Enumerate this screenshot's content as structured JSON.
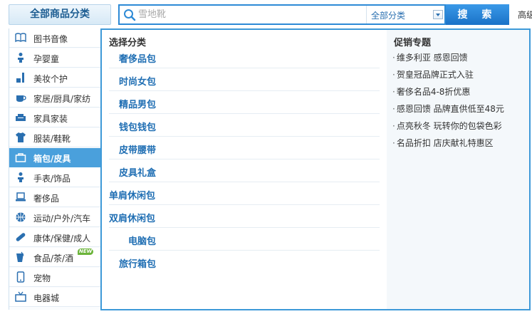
{
  "header": {
    "all_categories_label": "全部商品分类",
    "search_placeholder": "雪地靴",
    "search_category": "全部分类",
    "search_button": "搜 索",
    "advanced_search": "高级"
  },
  "sidebar": {
    "items": [
      {
        "label": "图书音像",
        "icon": "book-icon"
      },
      {
        "label": "孕婴童",
        "icon": "baby-icon"
      },
      {
        "label": "美妆个护",
        "icon": "cosmetics-icon"
      },
      {
        "label": "家居/厨具/家纺",
        "icon": "cup-icon"
      },
      {
        "label": "家具家装",
        "icon": "sofa-icon"
      },
      {
        "label": "服装/鞋靴",
        "icon": "shirt-icon"
      },
      {
        "label": "箱包/皮具",
        "icon": "bag-icon"
      },
      {
        "label": "手表/饰品",
        "icon": "watch-icon"
      },
      {
        "label": "奢侈品",
        "icon": "laptop-icon"
      },
      {
        "label": "运动/户外/汽车",
        "icon": "ball-icon"
      },
      {
        "label": "康体/保健/成人",
        "icon": "pill-icon"
      },
      {
        "label": "食品/茶/酒",
        "icon": "drink-icon",
        "badge": "NEW"
      },
      {
        "label": "宠物",
        "icon": "phone-icon"
      },
      {
        "label": "电器城",
        "icon": "tv-icon"
      }
    ],
    "active_index": 6
  },
  "panel": {
    "select_title": "选择分类",
    "subcategories": [
      "奢侈品包",
      "时尚女包",
      "精品男包",
      "钱包钱包",
      "皮带腰带",
      "皮具礼盒",
      "单肩休闲包",
      "双肩休闲包",
      "电脑包",
      "旅行箱包"
    ],
    "promo_title": "促销专题",
    "promos": [
      "维多利亚 感恩回馈",
      "贺皇冠品牌正式入驻",
      "奢侈名品4-8折优惠",
      "感恩回馈 品牌直供低至48元",
      "点亮秋冬 玩转你的包袋色彩",
      "名品折扣 店庆献礼特惠区"
    ]
  },
  "colors": {
    "accent": "#3d99d8",
    "link": "#1f6eb3",
    "active_bg": "#4aa0dc"
  }
}
